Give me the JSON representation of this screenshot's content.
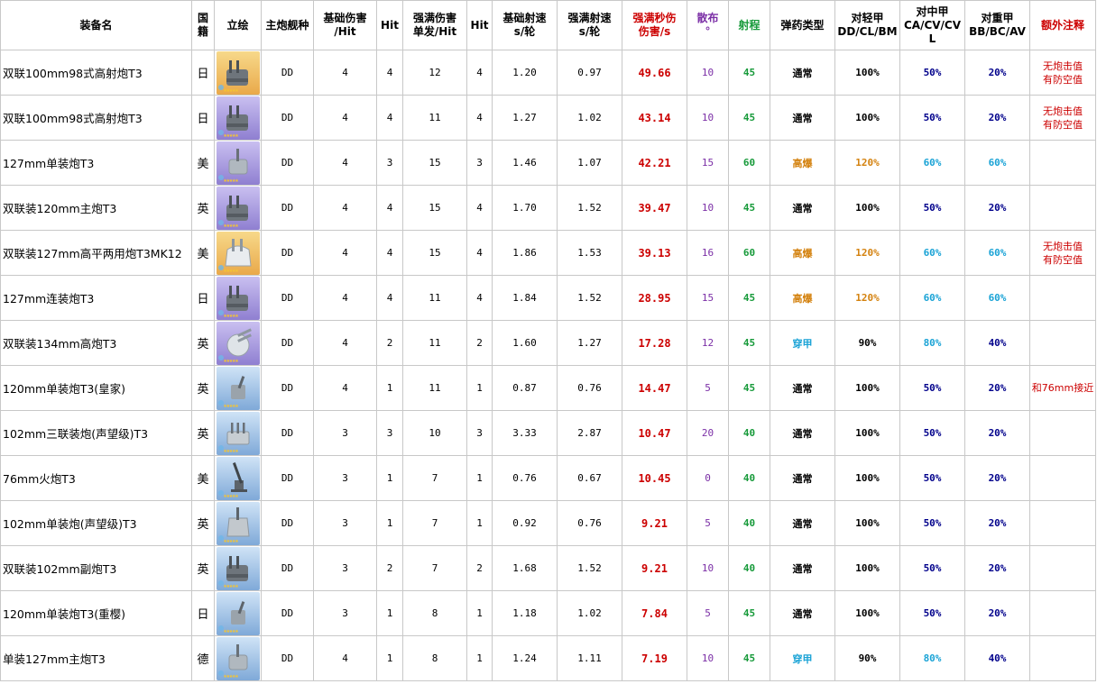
{
  "colors": {
    "rarity_gold": "#f0c060",
    "rarity_purple": "#9b8ad6",
    "rarity_blue": "#7fa9d8",
    "rarity_silver": "#b8c4cc",
    "dps_red": "#cc0000",
    "spread_purple": "#7b2fa6",
    "range_green": "#179a3a",
    "he_orange": "#d4820f",
    "ap_cyan": "#1aa3d6",
    "navy": "#00008b",
    "sky": "#1aa3d6"
  },
  "headers": [
    {
      "lines": [
        "装备名"
      ],
      "cls": ""
    },
    {
      "lines": [
        "国",
        "籍"
      ],
      "cls": ""
    },
    {
      "lines": [
        "立绘"
      ],
      "cls": ""
    },
    {
      "lines": [
        "主炮舰种"
      ],
      "cls": ""
    },
    {
      "lines": [
        "基础伤害",
        "/Hit"
      ],
      "cls": ""
    },
    {
      "lines": [
        "Hit"
      ],
      "cls": ""
    },
    {
      "lines": [
        "强满伤害",
        "单发/Hit"
      ],
      "cls": ""
    },
    {
      "lines": [
        "Hit"
      ],
      "cls": ""
    },
    {
      "lines": [
        "基础射速",
        "s/轮"
      ],
      "cls": ""
    },
    {
      "lines": [
        "强满射速",
        "s/轮"
      ],
      "cls": ""
    },
    {
      "lines": [
        "强满秒伤",
        "伤害/s"
      ],
      "cls": "h-dps"
    },
    {
      "lines": [
        "散布",
        "°"
      ],
      "cls": "h-spread"
    },
    {
      "lines": [
        "射程"
      ],
      "cls": "h-range"
    },
    {
      "lines": [
        "弹药类型"
      ],
      "cls": ""
    },
    {
      "lines": [
        "对轻甲",
        "DD/CL/BM"
      ],
      "cls": ""
    },
    {
      "lines": [
        "对中甲",
        "CA/CV/CV",
        "L"
      ],
      "cls": ""
    },
    {
      "lines": [
        "对重甲",
        "BB/BC/AV"
      ],
      "cls": ""
    },
    {
      "lines": [
        "额外注释"
      ],
      "cls": "h-note"
    }
  ],
  "rows": [
    {
      "name": "双联100mm98式高射炮T3",
      "nation": "日",
      "rarity": "gold",
      "icon": "twin-turret-icon",
      "ship": "DD",
      "base_dmg": "4",
      "hit1": "4",
      "max_dmg": "12",
      "hit2": "4",
      "base_rate": "1.20",
      "max_rate": "0.97",
      "dps": "49.66",
      "spread": "10",
      "range": "45",
      "ammo": "通常",
      "ammo_kind": "normal",
      "light": "100%",
      "light_kind": "normal",
      "medium": "50%",
      "medium_kind": "navy",
      "heavy": "20%",
      "heavy_kind": "navy",
      "note": [
        "无炮击值",
        "有防空值"
      ]
    },
    {
      "name": "双联100mm98式高射炮T3",
      "nation": "日",
      "rarity": "purple",
      "icon": "twin-turret-icon",
      "ship": "DD",
      "base_dmg": "4",
      "hit1": "4",
      "max_dmg": "11",
      "hit2": "4",
      "base_rate": "1.27",
      "max_rate": "1.02",
      "dps": "43.14",
      "spread": "10",
      "range": "45",
      "ammo": "通常",
      "ammo_kind": "normal",
      "light": "100%",
      "light_kind": "normal",
      "medium": "50%",
      "medium_kind": "navy",
      "heavy": "20%",
      "heavy_kind": "navy",
      "note": [
        "无炮击值",
        "有防空值"
      ]
    },
    {
      "name": "127mm单装炮T3",
      "nation": "美",
      "rarity": "purple",
      "icon": "single-turret-icon",
      "ship": "DD",
      "base_dmg": "4",
      "hit1": "3",
      "max_dmg": "15",
      "hit2": "3",
      "base_rate": "1.46",
      "max_rate": "1.07",
      "dps": "42.21",
      "spread": "15",
      "range": "60",
      "ammo": "高爆",
      "ammo_kind": "he",
      "light": "120%",
      "light_kind": "he",
      "medium": "60%",
      "medium_kind": "sky",
      "heavy": "60%",
      "heavy_kind": "sky",
      "note": []
    },
    {
      "name": "双联装120mm主炮T3",
      "nation": "英",
      "rarity": "purple",
      "icon": "twin-gun-icon",
      "ship": "DD",
      "base_dmg": "4",
      "hit1": "4",
      "max_dmg": "15",
      "hit2": "4",
      "base_rate": "1.70",
      "max_rate": "1.52",
      "dps": "39.47",
      "spread": "10",
      "range": "45",
      "ammo": "通常",
      "ammo_kind": "normal",
      "light": "100%",
      "light_kind": "normal",
      "medium": "50%",
      "medium_kind": "navy",
      "heavy": "20%",
      "heavy_kind": "navy",
      "note": []
    },
    {
      "name": "双联装127mm高平两用炮T3MK12",
      "nation": "美",
      "rarity": "gold",
      "icon": "dual-purpose-turret-icon",
      "ship": "DD",
      "base_dmg": "4",
      "hit1": "4",
      "max_dmg": "15",
      "hit2": "4",
      "base_rate": "1.86",
      "max_rate": "1.53",
      "dps": "39.13",
      "spread": "16",
      "range": "60",
      "ammo": "高爆",
      "ammo_kind": "he",
      "light": "120%",
      "light_kind": "he",
      "medium": "60%",
      "medium_kind": "sky",
      "heavy": "60%",
      "heavy_kind": "sky",
      "note": [
        "无炮击值",
        "有防空值"
      ]
    },
    {
      "name": "127mm连装炮T3",
      "nation": "日",
      "rarity": "purple",
      "icon": "twin-turret-icon",
      "ship": "DD",
      "base_dmg": "4",
      "hit1": "4",
      "max_dmg": "11",
      "hit2": "4",
      "base_rate": "1.84",
      "max_rate": "1.52",
      "dps": "28.95",
      "spread": "15",
      "range": "45",
      "ammo": "高爆",
      "ammo_kind": "he",
      "light": "120%",
      "light_kind": "he",
      "medium": "60%",
      "medium_kind": "sky",
      "heavy": "60%",
      "heavy_kind": "sky",
      "note": []
    },
    {
      "name": "双联装134mm高炮T3",
      "nation": "英",
      "rarity": "purple",
      "icon": "round-turret-icon",
      "ship": "DD",
      "base_dmg": "4",
      "hit1": "2",
      "max_dmg": "11",
      "hit2": "2",
      "base_rate": "1.60",
      "max_rate": "1.27",
      "dps": "17.28",
      "spread": "12",
      "range": "45",
      "ammo": "穿甲",
      "ammo_kind": "ap",
      "light": "90%",
      "light_kind": "normal",
      "medium": "80%",
      "medium_kind": "sky",
      "heavy": "40%",
      "heavy_kind": "navy",
      "note": []
    },
    {
      "name": "120mm单装炮T3(皇家)",
      "nation": "英",
      "rarity": "blue",
      "icon": "single-gun-icon",
      "ship": "DD",
      "base_dmg": "4",
      "hit1": "1",
      "max_dmg": "11",
      "hit2": "1",
      "base_rate": "0.87",
      "max_rate": "0.76",
      "dps": "14.47",
      "spread": "5",
      "range": "45",
      "ammo": "通常",
      "ammo_kind": "normal",
      "light": "100%",
      "light_kind": "normal",
      "medium": "50%",
      "medium_kind": "navy",
      "heavy": "20%",
      "heavy_kind": "navy",
      "note": [
        "和76mm接近"
      ]
    },
    {
      "name": "102mm三联装炮(声望级)T3",
      "nation": "英",
      "rarity": "blue",
      "icon": "triple-gun-icon",
      "ship": "DD",
      "base_dmg": "3",
      "hit1": "3",
      "max_dmg": "10",
      "hit2": "3",
      "base_rate": "3.33",
      "max_rate": "2.87",
      "dps": "10.47",
      "spread": "20",
      "range": "40",
      "ammo": "通常",
      "ammo_kind": "normal",
      "light": "100%",
      "light_kind": "normal",
      "medium": "50%",
      "medium_kind": "navy",
      "heavy": "20%",
      "heavy_kind": "navy",
      "note": []
    },
    {
      "name": "76mm火炮T3",
      "nation": "美",
      "rarity": "blue",
      "icon": "deck-gun-icon",
      "ship": "DD",
      "base_dmg": "3",
      "hit1": "1",
      "max_dmg": "7",
      "hit2": "1",
      "base_rate": "0.76",
      "max_rate": "0.67",
      "dps": "10.45",
      "spread": "0",
      "range": "40",
      "ammo": "通常",
      "ammo_kind": "normal",
      "light": "100%",
      "light_kind": "normal",
      "medium": "50%",
      "medium_kind": "navy",
      "heavy": "20%",
      "heavy_kind": "navy",
      "note": []
    },
    {
      "name": "102mm单装炮(声望级)T3",
      "nation": "英",
      "rarity": "blue",
      "icon": "shielded-gun-icon",
      "ship": "DD",
      "base_dmg": "3",
      "hit1": "1",
      "max_dmg": "7",
      "hit2": "1",
      "base_rate": "0.92",
      "max_rate": "0.76",
      "dps": "9.21",
      "spread": "5",
      "range": "40",
      "ammo": "通常",
      "ammo_kind": "normal",
      "light": "100%",
      "light_kind": "normal",
      "medium": "50%",
      "medium_kind": "navy",
      "heavy": "20%",
      "heavy_kind": "navy",
      "note": []
    },
    {
      "name": "双联装102mm副炮T3",
      "nation": "英",
      "rarity": "blue",
      "icon": "twin-gun-icon",
      "ship": "DD",
      "base_dmg": "3",
      "hit1": "2",
      "max_dmg": "7",
      "hit2": "2",
      "base_rate": "1.68",
      "max_rate": "1.52",
      "dps": "9.21",
      "spread": "10",
      "range": "40",
      "ammo": "通常",
      "ammo_kind": "normal",
      "light": "100%",
      "light_kind": "normal",
      "medium": "50%",
      "medium_kind": "navy",
      "heavy": "20%",
      "heavy_kind": "navy",
      "note": []
    },
    {
      "name": "120mm单装炮T3(重樱)",
      "nation": "日",
      "rarity": "blue",
      "icon": "single-gun-icon",
      "ship": "DD",
      "base_dmg": "3",
      "hit1": "1",
      "max_dmg": "8",
      "hit2": "1",
      "base_rate": "1.18",
      "max_rate": "1.02",
      "dps": "7.84",
      "spread": "5",
      "range": "45",
      "ammo": "通常",
      "ammo_kind": "normal",
      "light": "100%",
      "light_kind": "normal",
      "medium": "50%",
      "medium_kind": "navy",
      "heavy": "20%",
      "heavy_kind": "navy",
      "note": []
    },
    {
      "name": "单装127mm主炮T3",
      "nation": "德",
      "rarity": "blue",
      "icon": "single-turret-icon",
      "ship": "DD",
      "base_dmg": "4",
      "hit1": "1",
      "max_dmg": "8",
      "hit2": "1",
      "base_rate": "1.24",
      "max_rate": "1.11",
      "dps": "7.19",
      "spread": "10",
      "range": "45",
      "ammo": "穿甲",
      "ammo_kind": "ap",
      "light": "90%",
      "light_kind": "normal",
      "medium": "80%",
      "medium_kind": "sky",
      "heavy": "40%",
      "heavy_kind": "navy",
      "note": []
    }
  ]
}
